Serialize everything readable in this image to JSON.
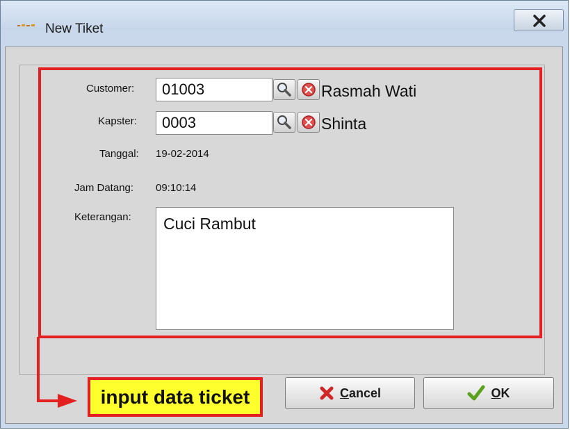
{
  "window": {
    "title": "New Tiket"
  },
  "form": {
    "customer_label": "Customer:",
    "customer_value": "01003",
    "customer_name": "Rasmah Wati",
    "kapster_label": "Kapster:",
    "kapster_value": "0003",
    "kapster_name": "Shinta",
    "tanggal_label": "Tanggal:",
    "tanggal_value": "19-02-2014",
    "jam_label": "Jam Datang:",
    "jam_value": "09:10:14",
    "keterangan_label": "Keterangan:",
    "keterangan_value": "Cuci Rambut"
  },
  "annotation": {
    "text": "input data ticket",
    "color": "#e41f1f",
    "highlight": "#ffff2d"
  },
  "buttons": {
    "cancel_accel": "C",
    "cancel_rest": "ancel",
    "ok_accel": "O",
    "ok_rest": "K"
  },
  "icons": {
    "search": "magnifier-icon",
    "clear": "red-x-circle-icon",
    "cancel": "red-x-icon",
    "ok": "green-check-icon"
  }
}
